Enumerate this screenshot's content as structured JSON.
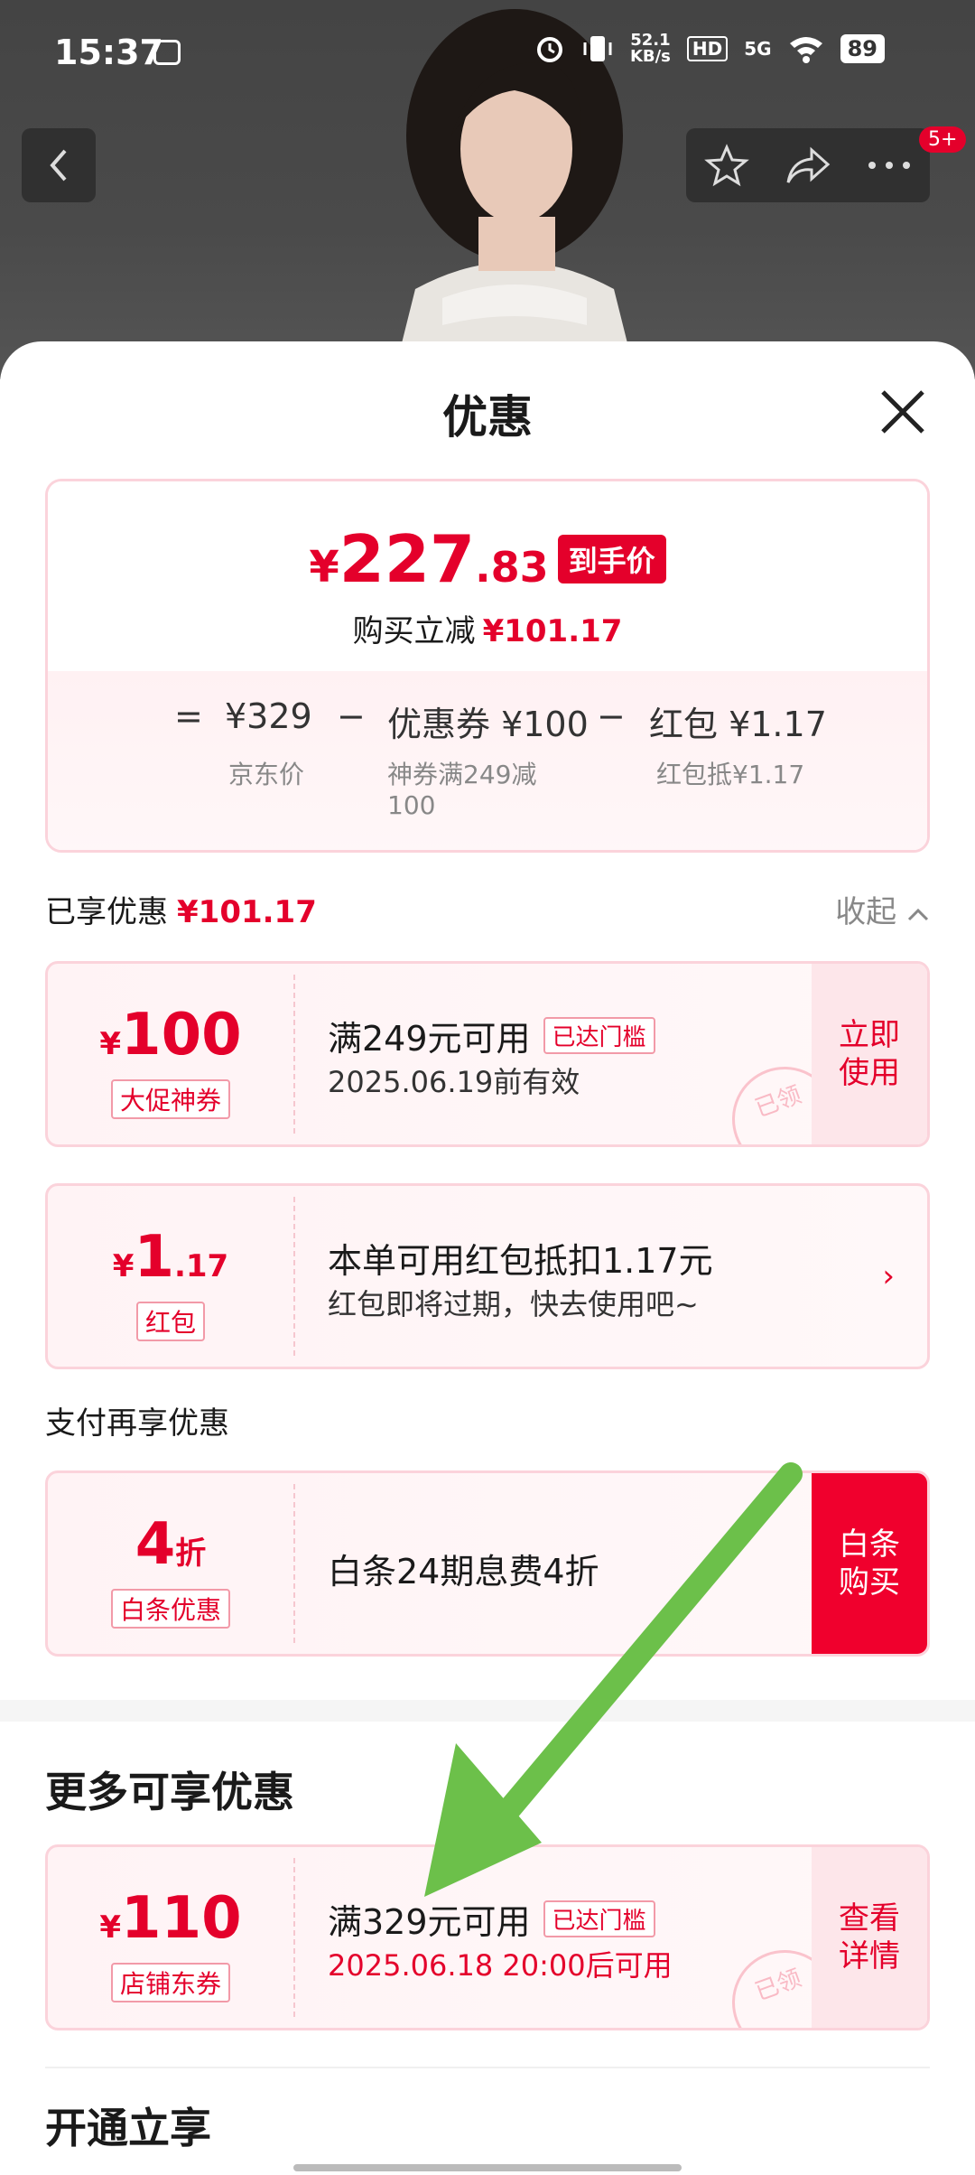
{
  "status_bar": {
    "time": "15:37",
    "speed_value": "52.1",
    "speed_unit": "KB/s",
    "hd": "HD",
    "network": "5G",
    "battery": "89"
  },
  "header": {
    "badge": "5+"
  },
  "sheet": {
    "title": "优惠"
  },
  "price_card": {
    "currency": "¥",
    "price_int": "227",
    "price_dec": ".83",
    "price_tag": "到手价",
    "sub_label": "购买立减",
    "sub_value": "¥101.17",
    "formula": {
      "equals": "=",
      "base": "¥329",
      "base_label": "京东价",
      "minus": "−",
      "coupon": "优惠券 ¥100",
      "coupon_label": "神券满249减100",
      "minus2": "−",
      "redpacket": "红包 ¥1.17",
      "redpacket_label": "红包抵¥1.17"
    }
  },
  "enjoyed": {
    "label": "已享优惠",
    "value": "¥101.17",
    "collapse": "收起"
  },
  "coupons": [
    {
      "currency": "¥",
      "amount": "100",
      "tag": "大促神券",
      "line1": "满249元可用",
      "threshold": "已达门槛",
      "line2": "2025.06.19前有效",
      "action": "立即使用",
      "stamp": "已领"
    },
    {
      "currency": "¥",
      "amount": "1",
      "amount_small": ".17",
      "tag": "红包",
      "line1": "本单可用红包抵扣1.17元",
      "line2": "红包即将过期，快去使用吧~",
      "arrow": "›"
    }
  ],
  "pay_section": {
    "label": "支付再享优惠",
    "coupon": {
      "amount": "4",
      "amount_unit": "折",
      "tag": "白条优惠",
      "line1": "白条24期息费4折",
      "action": "白条购买"
    }
  },
  "more_section": {
    "title": "更多可享优惠",
    "coupon": {
      "currency": "¥",
      "amount": "110",
      "tag": "店铺东券",
      "line1": "满329元可用",
      "threshold": "已达门槛",
      "line2": "2025.06.18 20:00后可用",
      "action": "查看详情",
      "stamp": "已领"
    }
  },
  "open_section": {
    "title": "开通立享"
  },
  "colors": {
    "accent": "#e4002b",
    "annotation_arrow": "#6cc04a"
  }
}
